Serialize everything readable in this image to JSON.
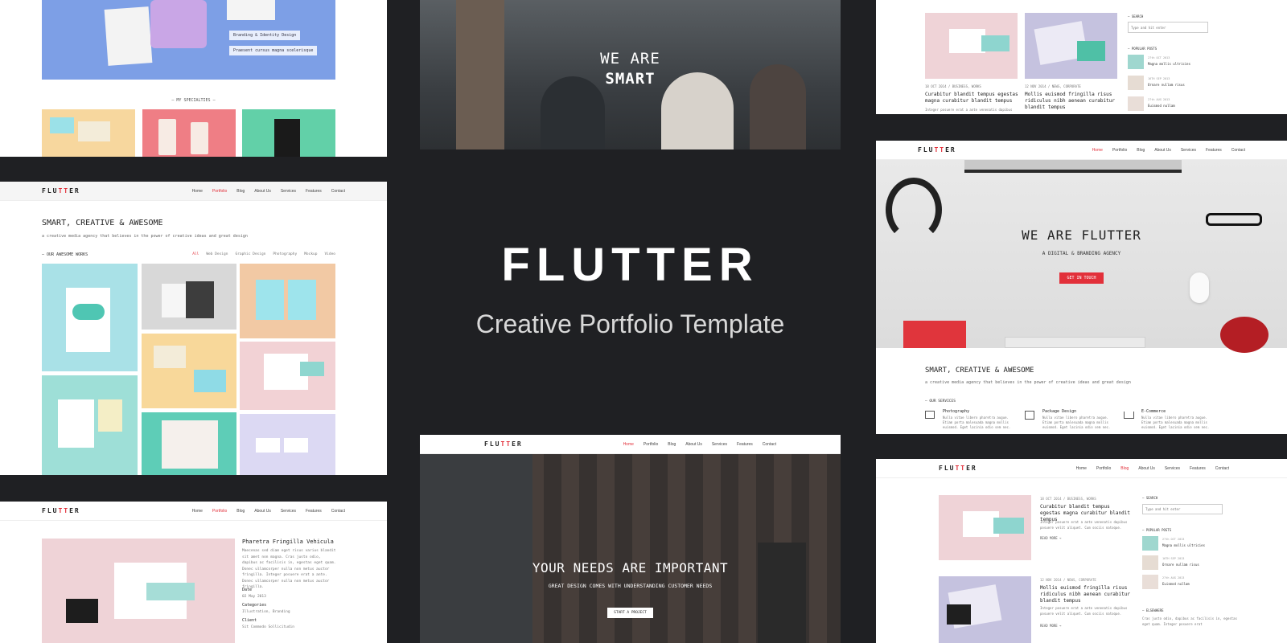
{
  "center": {
    "brand": "FLUTTER",
    "tagline": "Creative Portfolio Template"
  },
  "nav": {
    "logo_prefix": "FLU",
    "logo_accent": "TT",
    "logo_suffix": "ER",
    "items": [
      "Home",
      "Portfolio",
      "Blog",
      "About Us",
      "Services",
      "Features",
      "Contact"
    ]
  },
  "tl": {
    "labels": [
      "Branding & Identity Design",
      "Praesent cursus magna scelerisque"
    ],
    "specialties": "— MY SPECIALTIES —"
  },
  "tc": {
    "line1": "WE ARE",
    "line2": "SMART"
  },
  "tr": {
    "search_label": "— SEARCH",
    "search_placeholder": "Type and hit enter",
    "popular_label": "— POPULAR POSTS",
    "popular": [
      {
        "date": "27th OCT 2013",
        "title": "Magna mollis ultricies"
      },
      {
        "date": "16TH SEP 2013",
        "title": "Ornare nullam risus"
      },
      {
        "date": "27th AUG 2013",
        "title": "Euismod nullam"
      }
    ],
    "posts": [
      {
        "meta": "18 OCT 2014 / BUSINESS, WORKS",
        "title": "Curabitur blandit tempus egestas magna curabitur blandit tempus",
        "excerpt": "Integer posuere erat a ante venenatis dapibus"
      },
      {
        "meta": "12 NOV 2014 / NEWS, CORPORATE",
        "title": "Mollis euismod fringilla risus ridiculus nibh aenean curabitur blandit tempus",
        "excerpt": ""
      }
    ]
  },
  "ml": {
    "title": "SMART, CREATIVE & AWESOME",
    "subtitle": "a creative media agency that believes in the power of creative ideas and great design",
    "works_label": "— OUR AWESOME WORKS",
    "filters": [
      "All",
      "Web Design",
      "Graphic Design",
      "Photography",
      "Mockup",
      "Video"
    ]
  },
  "mr": {
    "hero_title": "WE ARE FLUTTER",
    "hero_sub": "A DIGITAL & BRANDING AGENCY",
    "cta": "GET IN TOUCH",
    "title": "SMART, CREATIVE & AWESOME",
    "subtitle": "a creative media agency that believes in the power of creative ideas and great design",
    "services_label": "— OUR SERVICES",
    "services": [
      {
        "name": "Photography",
        "desc": "Nulla vitae libero pharetra augue. Etiam porta malesuada magna mollis euismod. Eget lacinia odio sem nec."
      },
      {
        "name": "Package Design",
        "desc": "Nulla vitae libero pharetra augue. Etiam porta malesuada magna mollis euismod. Eget lacinia odio sem nec."
      },
      {
        "name": "E-Commerce",
        "desc": "Nulla vitae libero pharetra augue. Etiam porta malesuada magna mollis euismod. Eget lacinia odio sem nec."
      }
    ]
  },
  "bl": {
    "title": "Pharetra Fringilla Vehicula",
    "body": "Maecenas sed diam eget risus varius blandit sit amet non magna. Cras justo odio, dapibus ac facilisis in, egestas eget quam. Donec ullamcorper nulla non metus auctor fringilla. Integer posuere erat a ante. Donec ullamcorper nulla non metus auctor fringilla.",
    "date_label": "Date",
    "date": "02 May 2013",
    "cat_label": "Categories",
    "cats": "Illustration, Branding",
    "client_label": "Client",
    "client": "Sit Commodo Sollicitudin"
  },
  "bc": {
    "title": "YOUR NEEDS ARE IMPORTANT",
    "sub": "GREAT DESIGN COMES WITH UNDERSTANDING CUSTOMER NEEDS",
    "cta": "START A PROJECT"
  },
  "br": {
    "posts": [
      {
        "meta": "18 OCT 2014 / BUSINESS, WORKS",
        "title": "Curabitur blandit tempus egestas magna curabitur blandit tempus",
        "excerpt": "Integer posuere erat a ante venenatis dapibus posuere velit aliquet. Cum sociis natoque.",
        "more": "READ MORE →"
      },
      {
        "meta": "12 NOV 2014 / NEWS, CORPORATE",
        "title": "Mollis euismod fringilla risus ridiculus nibh aenean curabitur blandit tempus",
        "excerpt": "Integer posuere erat a ante venenatis dapibus posuere velit aliquet. Cum sociis natoque.",
        "more": "READ MORE →"
      }
    ],
    "search_label": "— SEARCH",
    "search_placeholder": "Type and hit enter",
    "popular_label": "— POPULAR POSTS",
    "popular": [
      {
        "date": "27th OCT 2013",
        "title": "Magna mollis ultricies"
      },
      {
        "date": "16TH SEP 2013",
        "title": "Ornare nullam risus"
      },
      {
        "date": "27th AUG 2013",
        "title": "Euismod nullam"
      }
    ],
    "elsewhere_label": "— ELSEWHERE",
    "elsewhere": "Cras justo odio, dapibus ac facilisis in, egestas eget quam. Integer posuere erat"
  }
}
